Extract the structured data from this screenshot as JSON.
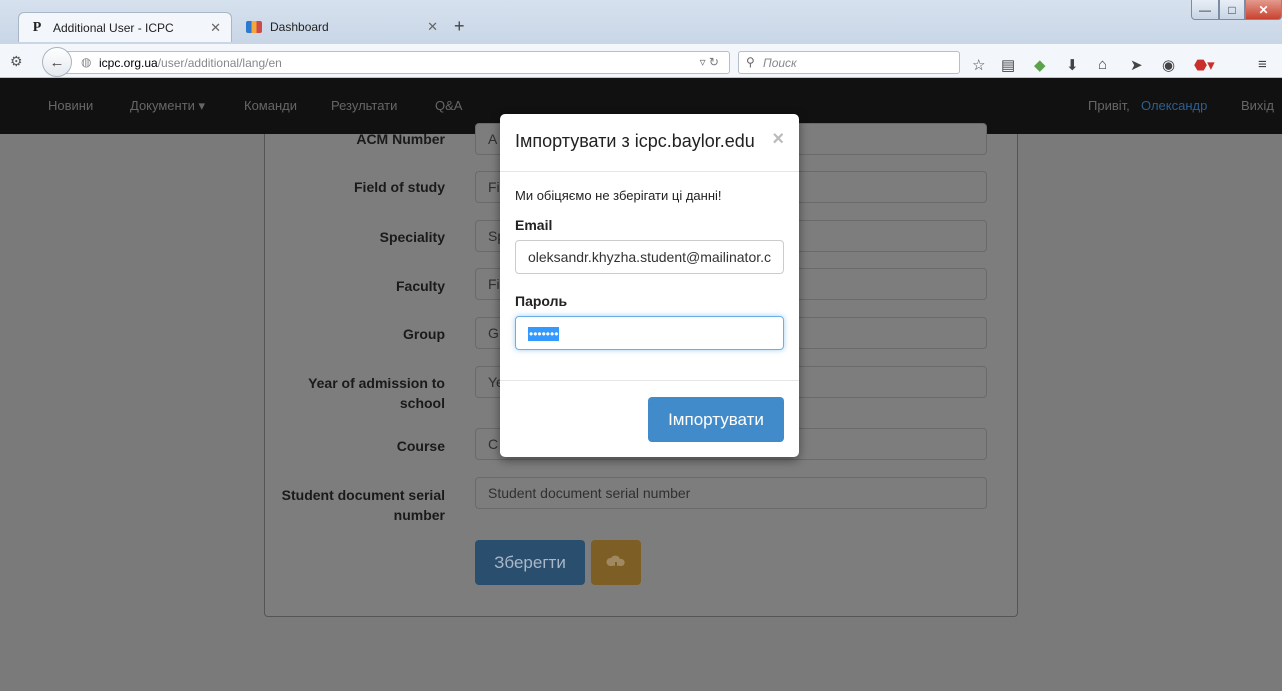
{
  "browser": {
    "tabs": [
      {
        "title": "Additional User - ICPC",
        "favicon": "P"
      },
      {
        "title": "Dashboard"
      }
    ],
    "url_host": "icpc.org.ua",
    "url_path": "/user/additional/lang/en",
    "search_placeholder": "Поиск"
  },
  "site_nav": {
    "items": [
      "Новини",
      "Документи ▾",
      "Команди",
      "Результати",
      "Q&A"
    ],
    "greeting": "Привіт,",
    "user": "Олександр",
    "logout": "Вихід"
  },
  "form": {
    "fields": [
      {
        "label": "ACM Number",
        "value": "A"
      },
      {
        "label": "Field of study",
        "value": "Fi"
      },
      {
        "label": "Speciality",
        "value": "Sp"
      },
      {
        "label": "Faculty",
        "value": "Fi"
      },
      {
        "label": "Group",
        "value": "G"
      },
      {
        "label": "Year of admission to school",
        "value": "Ye"
      },
      {
        "label": "Course",
        "value": "C"
      },
      {
        "label": "Student document serial number",
        "value": "Student document serial number"
      }
    ],
    "save_label": "Зберегти"
  },
  "modal": {
    "title": "Імпортувати з icpc.baylor.edu",
    "close": "×",
    "note": "Ми обіцяємо не зберігати ці данні!",
    "email_label": "Email",
    "email_value": "oleksandr.khyzha.student@mailinator.c",
    "password_label": "Пароль",
    "password_value": "•••••••",
    "import_label": "Імпортувати"
  }
}
